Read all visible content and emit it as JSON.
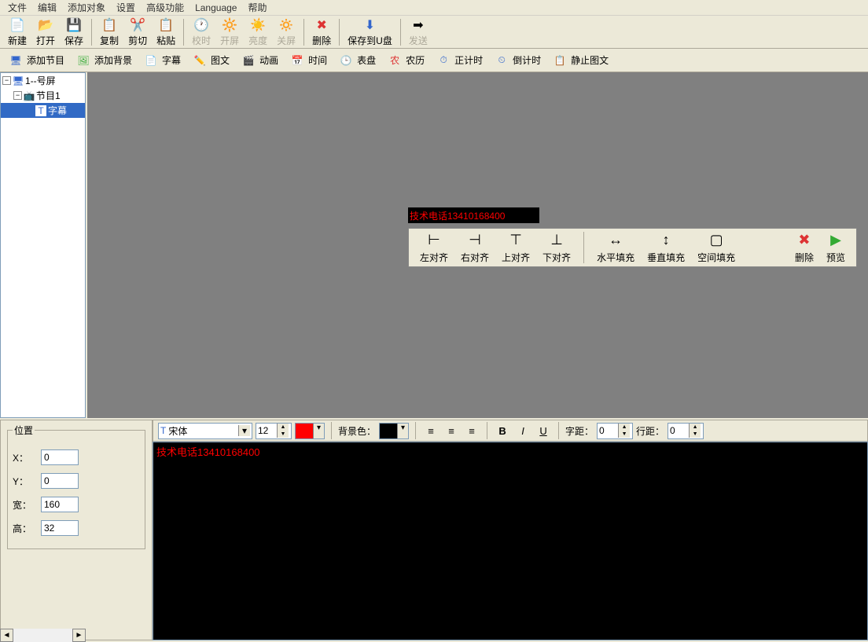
{
  "menu": [
    "文件",
    "编辑",
    "添加对象",
    "设置",
    "高级功能",
    "Language",
    "帮助"
  ],
  "toolbar1": {
    "new": "新建",
    "open": "打开",
    "save": "保存",
    "copy": "复制",
    "cut": "剪切",
    "paste": "粘贴",
    "sync": "校时",
    "openScreen": "开屏",
    "brightness": "亮度",
    "closeScreen": "关屏",
    "delete": "删除",
    "saveUsb": "保存到U盘",
    "send": "发送"
  },
  "toolbar2": {
    "addProgram": "添加节目",
    "addBg": "添加背景",
    "subtitle": "字幕",
    "imgText": "图文",
    "anim": "动画",
    "time": "时间",
    "dial": "表盘",
    "lunar": "农历",
    "countUp": "正计时",
    "countDown": "倒计时",
    "staticImg": "静止图文"
  },
  "tree": {
    "root": "1--号屏",
    "program": "节目1",
    "subtitle": "字幕"
  },
  "preview": {
    "text": "技术电话13410168400"
  },
  "floatbar": {
    "alignL": "左对齐",
    "alignR": "右对齐",
    "alignT": "上对齐",
    "alignB": "下对齐",
    "fillH": "水平填充",
    "fillV": "垂直填充",
    "fillSpace": "空间填充",
    "delete": "删除",
    "preview": "预览"
  },
  "position": {
    "legend": "位置",
    "xLabel": "X：",
    "yLabel": "Y：",
    "wLabel": "宽：",
    "hLabel": "高：",
    "x": "0",
    "y": "0",
    "w": "160",
    "h": "32"
  },
  "editbar": {
    "font": "宋体",
    "size": "12",
    "bgLabel": "背景色：",
    "charSpaceLabel": "字距：",
    "charSpace": "0",
    "lineSpaceLabel": "行距：",
    "lineSpace": "0"
  },
  "editor": {
    "text": "技术电话13410168400"
  }
}
